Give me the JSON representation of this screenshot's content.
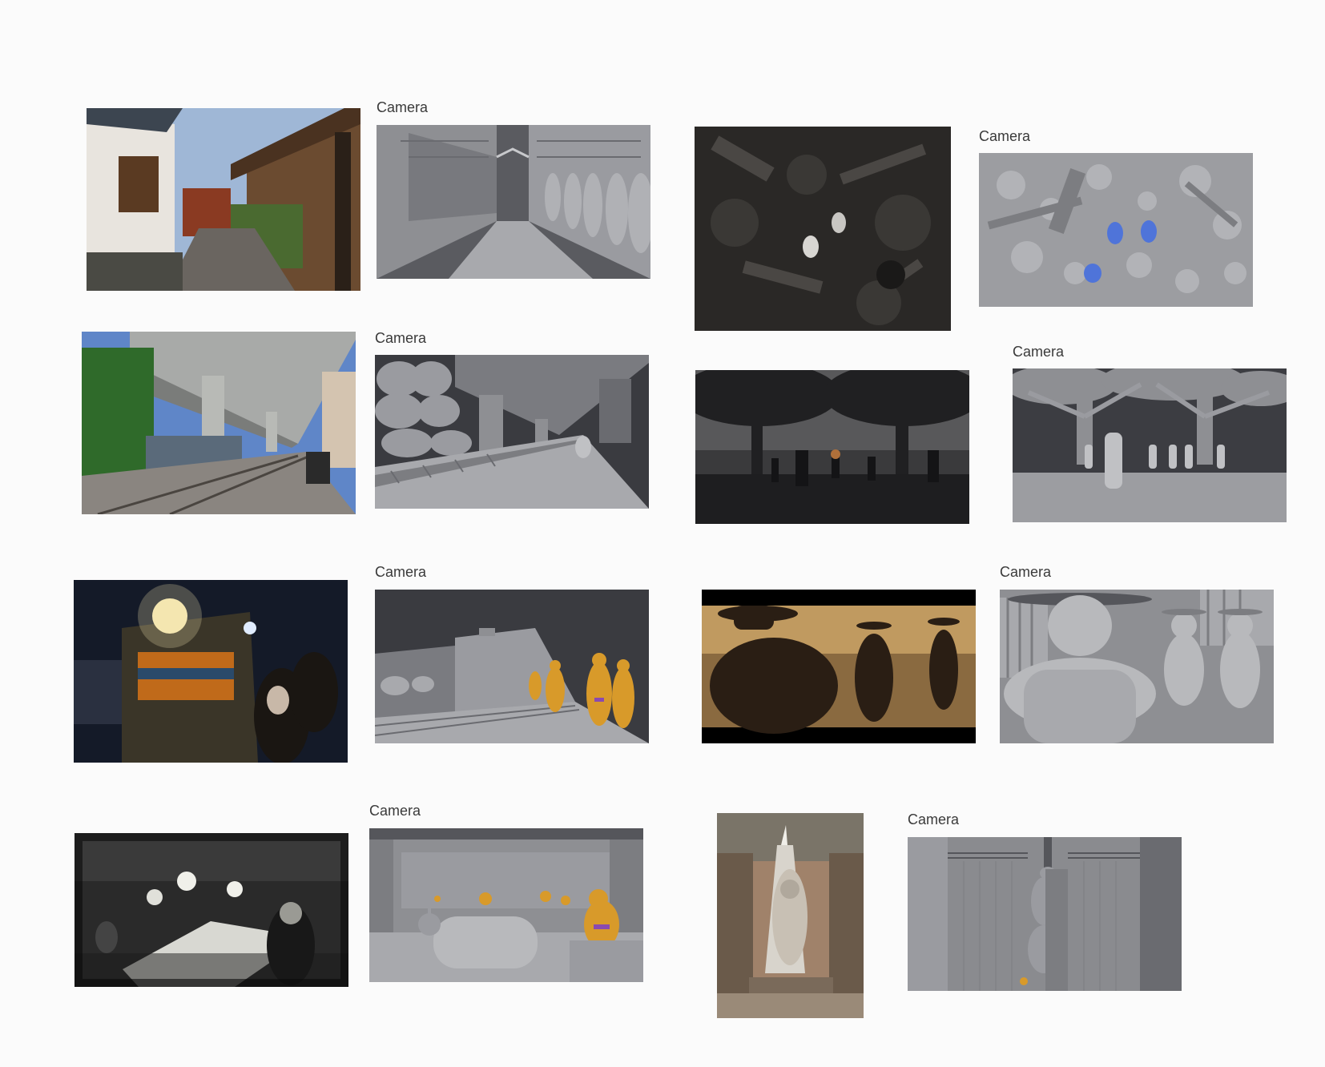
{
  "canvas": {
    "background": "#fbfbfb"
  },
  "labels": {
    "camera": "Camera"
  },
  "colors": {
    "blockout_gray": "#8e8f93",
    "blockout_dark": "#55565b",
    "mannequin_orange": "#d89a2a",
    "selection_blue": "#4f74d9",
    "label_text": "#3a3a3a"
  },
  "pairs": [
    {
      "reference": "street-alley-photo",
      "blockout": "street-alley-blockout",
      "label": "Camera"
    },
    {
      "reference": "forest-floor-render",
      "blockout": "forest-floor-blockout",
      "label": "Camera"
    },
    {
      "reference": "railway-under-overpass-photo",
      "blockout": "railway-overpass-blockout",
      "label": "Camera"
    },
    {
      "reference": "misty-trees-figures-render",
      "blockout": "trees-figures-blockout",
      "label": "Camera"
    },
    {
      "reference": "night-train-station-photo",
      "blockout": "train-platform-blockout",
      "label": "Camera"
    },
    {
      "reference": "cowboys-sunset-render",
      "blockout": "cowboys-blockout",
      "label": "Camera"
    },
    {
      "reference": "saloon-interior-render",
      "blockout": "saloon-blockout",
      "label": "Camera"
    },
    {
      "reference": "buddha-temple-photo",
      "blockout": "buddha-temple-blockout",
      "label": "Camera"
    }
  ]
}
